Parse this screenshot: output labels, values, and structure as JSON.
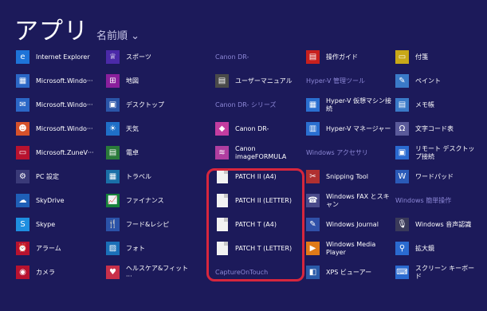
{
  "header": {
    "title": "アプリ",
    "sort": "名前順 ⌄"
  },
  "columns": [
    {
      "items": [
        {
          "type": "tile",
          "label": "Internet Explorer",
          "icon": "ie-icon",
          "color": "#1e73d8",
          "glyph": "e"
        },
        {
          "type": "tile",
          "label": "Microsoft.Windo···",
          "icon": "calculator-icon",
          "color": "#2b67c6",
          "glyph": "▦"
        },
        {
          "type": "tile",
          "label": "Microsoft.Windo···",
          "icon": "mail-icon",
          "color": "#2b67c6",
          "glyph": "✉"
        },
        {
          "type": "tile",
          "label": "Microsoft.Windo···",
          "icon": "people-icon",
          "color": "#d5522b",
          "glyph": "☻"
        },
        {
          "type": "tile",
          "label": "Microsoft.ZuneV···",
          "icon": "video-icon",
          "color": "#b8122f",
          "glyph": "▭"
        },
        {
          "type": "tile",
          "label": "PC 設定",
          "icon": "gear-icon",
          "color": "#3a3a78",
          "glyph": "⚙"
        },
        {
          "type": "tile",
          "label": "SkyDrive",
          "icon": "cloud-icon",
          "color": "#1f5fb7",
          "glyph": "☁"
        },
        {
          "type": "tile",
          "label": "Skype",
          "icon": "skype-icon",
          "color": "#1e8ee0",
          "glyph": "S"
        },
        {
          "type": "tile",
          "label": "アラーム",
          "icon": "alarm-icon",
          "color": "#b8122f",
          "glyph": "⏰"
        },
        {
          "type": "tile",
          "label": "カメラ",
          "icon": "camera-icon",
          "color": "#b8122f",
          "glyph": "◉"
        }
      ]
    },
    {
      "items": [
        {
          "type": "tile",
          "label": "スポーツ",
          "icon": "trophy-icon",
          "color": "#4b2aa8",
          "glyph": "♕"
        },
        {
          "type": "tile",
          "label": "地図",
          "icon": "map-icon",
          "color": "#8a1f9c",
          "glyph": "⊞"
        },
        {
          "type": "tile",
          "label": "デスクトップ",
          "icon": "desktop-icon",
          "color": "#2a55a8",
          "glyph": "▣"
        },
        {
          "type": "tile",
          "label": "天気",
          "icon": "weather-icon",
          "color": "#1f6fc8",
          "glyph": "☀"
        },
        {
          "type": "tile",
          "label": "電卓",
          "icon": "calc-icon",
          "color": "#2a7a3a",
          "glyph": "▤"
        },
        {
          "type": "tile",
          "label": "トラベル",
          "icon": "travel-icon",
          "color": "#1a6fa8",
          "glyph": "▦"
        },
        {
          "type": "tile",
          "label": "ファイナンス",
          "icon": "finance-icon",
          "color": "#16803a",
          "glyph": "📈"
        },
        {
          "type": "tile",
          "label": "フード&レシピ",
          "icon": "food-icon",
          "color": "#2a52a8",
          "glyph": "🍴"
        },
        {
          "type": "tile",
          "label": "フォト",
          "icon": "photo-icon",
          "color": "#1a6fb8",
          "glyph": "▨"
        },
        {
          "type": "tile",
          "label": "ヘルスケア&フィット···",
          "icon": "health-icon",
          "color": "#c8304a",
          "glyph": "♥"
        }
      ]
    },
    {
      "items": [
        {
          "type": "group",
          "label": "Canon DR-"
        },
        {
          "type": "tile",
          "label": "ユーザーマニュアル",
          "icon": "document-icon",
          "color": "#4a4a4a",
          "glyph": "▤"
        },
        {
          "type": "group",
          "label": "Canon DR-     シリーズ"
        },
        {
          "type": "tile",
          "label": "Canon DR-",
          "icon": "scanner-icon",
          "color": "#c33da0",
          "glyph": "◆"
        },
        {
          "type": "tile",
          "label": "Canon imageFORMULA",
          "icon": "canon-icon",
          "color": "#b03ea0",
          "glyph": "≋"
        },
        {
          "type": "tile",
          "label": "PATCH II (A4)",
          "icon": "document-icon",
          "doc": true
        },
        {
          "type": "tile",
          "label": "PATCH II (LETTER)",
          "icon": "document-icon",
          "doc": true
        },
        {
          "type": "tile",
          "label": "PATCH T (A4)",
          "icon": "document-icon",
          "doc": true
        },
        {
          "type": "tile",
          "label": "PATCH T (LETTER)",
          "icon": "document-icon",
          "doc": true
        },
        {
          "type": "group",
          "label": "CaptureOnTouch"
        }
      ]
    },
    {
      "items": [
        {
          "type": "tile",
          "label": "操作ガイド",
          "icon": "pdf-icon",
          "color": "#c8201e",
          "glyph": "▤"
        },
        {
          "type": "group",
          "label": "Hyper-V 管理ツール"
        },
        {
          "type": "tile",
          "label": "Hyper-V 仮想マシン接続",
          "icon": "hyperv-icon",
          "color": "#2a6fd0",
          "glyph": "▦"
        },
        {
          "type": "tile",
          "label": "Hyper-V マネージャー",
          "icon": "hyperv-manager-icon",
          "color": "#2a6fd0",
          "glyph": "▥"
        },
        {
          "type": "group",
          "label": "Windows アクセサリ"
        },
        {
          "type": "tile",
          "label": "Snipping Tool",
          "icon": "scissors-icon",
          "color": "#b03030",
          "glyph": "✂"
        },
        {
          "type": "tile",
          "label": "Windows FAX とスキャン",
          "icon": "fax-icon",
          "color": "#4a4a8a",
          "glyph": "☎"
        },
        {
          "type": "tile",
          "label": "Windows Journal",
          "icon": "journal-icon",
          "color": "#3050a8",
          "glyph": "✎"
        },
        {
          "type": "tile",
          "label": "Windows Media Player",
          "icon": "media-player-icon",
          "color": "#e07a18",
          "glyph": "▶"
        },
        {
          "type": "tile",
          "label": "XPS ビューアー",
          "icon": "xps-icon",
          "color": "#2a5aa8",
          "glyph": "◧"
        }
      ]
    },
    {
      "items": [
        {
          "type": "tile",
          "label": "付箋",
          "icon": "sticky-note-icon",
          "color": "#c8a818",
          "glyph": "▭"
        },
        {
          "type": "tile",
          "label": "ペイント",
          "icon": "paint-icon",
          "color": "#3a7ac8",
          "glyph": "✎"
        },
        {
          "type": "tile",
          "label": "メモ帳",
          "icon": "notepad-icon",
          "color": "#3a7ac8",
          "glyph": "▤"
        },
        {
          "type": "tile",
          "label": "文字コード表",
          "icon": "charmap-icon",
          "color": "#5a5a9a",
          "glyph": "Ω"
        },
        {
          "type": "tile",
          "label": "リモート デスクトップ接続",
          "icon": "remote-desktop-icon",
          "color": "#2a6ad0",
          "glyph": "▣"
        },
        {
          "type": "tile",
          "label": "ワードパッド",
          "icon": "wordpad-icon",
          "color": "#2a5ab8",
          "glyph": "W"
        },
        {
          "type": "group",
          "label": "Windows 簡単操作"
        },
        {
          "type": "tile",
          "label": "Windows 音声認識",
          "icon": "microphone-icon",
          "color": "#3a3a5a",
          "glyph": "🎙"
        },
        {
          "type": "tile",
          "label": "拡大鏡",
          "icon": "magnifier-icon",
          "color": "#2a6ad0",
          "glyph": "⚲"
        },
        {
          "type": "tile",
          "label": "スクリーン キーボード",
          "icon": "keyboard-icon",
          "color": "#2a6ad0",
          "glyph": "⌨"
        }
      ]
    }
  ]
}
